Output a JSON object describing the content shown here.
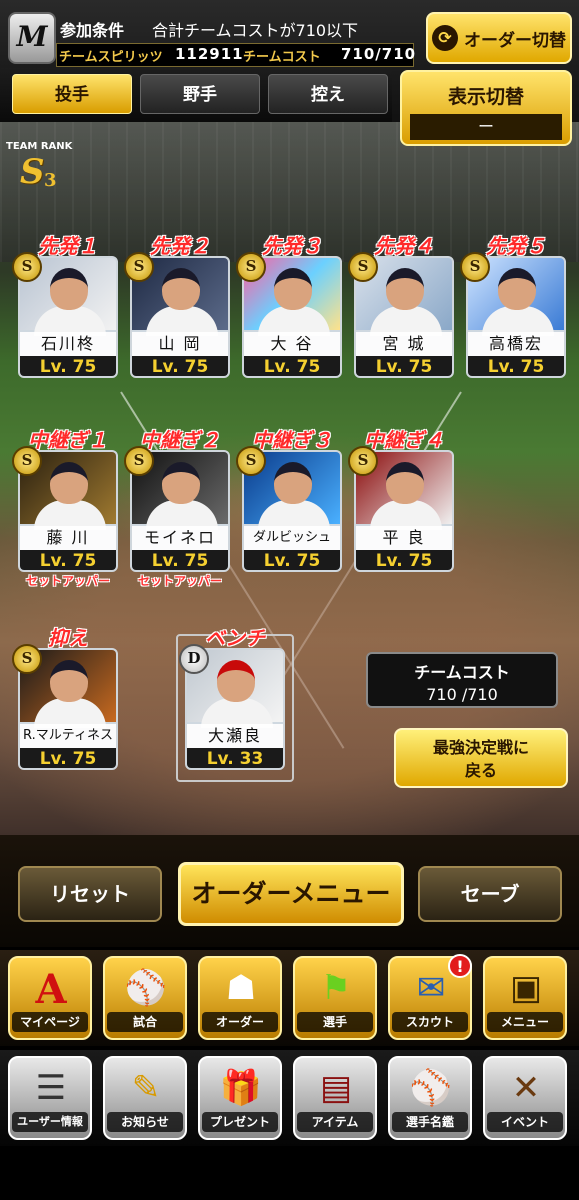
{
  "header": {
    "logo": "M",
    "condition_label": "参加条件",
    "condition_text": "合計チームコストが710以下",
    "spirits_label": "チームスピリッツ",
    "spirits_value": "112911",
    "cost_label": "チームコスト",
    "cost_value": "710/710",
    "order_switch_label": "オーダー切替"
  },
  "tabs": [
    {
      "label": "投手",
      "active": true
    },
    {
      "label": "野手",
      "active": false
    },
    {
      "label": "控え",
      "active": false
    }
  ],
  "display_switch": {
    "label": "表示切替",
    "value": "ー"
  },
  "team_rank": {
    "caption": "TEAM RANK",
    "rank": "S",
    "sub": "3"
  },
  "starters": [
    {
      "slot": "先発１",
      "name": "石川柊",
      "level": "Lv. 75",
      "badge": "S"
    },
    {
      "slot": "先発２",
      "name": "山 岡",
      "level": "Lv. 75",
      "badge": "S"
    },
    {
      "slot": "先発３",
      "name": "大 谷",
      "level": "Lv. 75",
      "badge": "S"
    },
    {
      "slot": "先発４",
      "name": "宮 城",
      "level": "Lv. 75",
      "badge": "S"
    },
    {
      "slot": "先発５",
      "name": "高橋宏",
      "level": "Lv. 75",
      "badge": "S"
    }
  ],
  "relievers": [
    {
      "slot": "中継ぎ１",
      "name": "藤 川",
      "level": "Lv. 75",
      "badge": "S",
      "role": "セットアッパー"
    },
    {
      "slot": "中継ぎ２",
      "name": "モイネロ",
      "level": "Lv. 75",
      "badge": "S",
      "role": "セットアッパー"
    },
    {
      "slot": "中継ぎ３",
      "name": "ダルビッシュ",
      "level": "Lv. 75",
      "badge": "S",
      "role": ""
    },
    {
      "slot": "中継ぎ４",
      "name": "平 良",
      "level": "Lv. 75",
      "badge": "S",
      "role": ""
    }
  ],
  "closer": {
    "slot": "抑え",
    "name": "R.マルティネス",
    "level": "Lv. 75",
    "badge": "S"
  },
  "bench": {
    "slot": "ベンチ",
    "name": "大瀬良",
    "level": "Lv. 33",
    "badge": "D"
  },
  "team_cost": {
    "label": "チームコスト",
    "value": "710 /710"
  },
  "return_button": {
    "line1": "最強決定戦に",
    "line2": "戻る"
  },
  "actions": {
    "reset": "リセット",
    "order_menu": "オーダーメニュー",
    "save": "セーブ"
  },
  "nav_primary": [
    {
      "label": "マイページ",
      "icon": "A"
    },
    {
      "label": "試合",
      "icon": "⚾"
    },
    {
      "label": "オーダー",
      "icon": "☗"
    },
    {
      "label": "選手",
      "icon": "⚑"
    },
    {
      "label": "スカウト",
      "icon": "✉"
    },
    {
      "label": "メニュー",
      "icon": "▣"
    }
  ],
  "nav_secondary": [
    {
      "label": "ユーザー情報",
      "icon": "☰"
    },
    {
      "label": "お知らせ",
      "icon": "✎"
    },
    {
      "label": "プレゼント",
      "icon": "🎁"
    },
    {
      "label": "アイテム",
      "icon": "▤"
    },
    {
      "label": "選手名鑑",
      "icon": "⚾"
    },
    {
      "label": "イベント",
      "icon": "✕"
    }
  ],
  "scout_notification": "!",
  "colors": {
    "accent_gold": "#f2c94c",
    "slot_red": "#ff2a2a",
    "level_yellow": "#f5d030"
  }
}
